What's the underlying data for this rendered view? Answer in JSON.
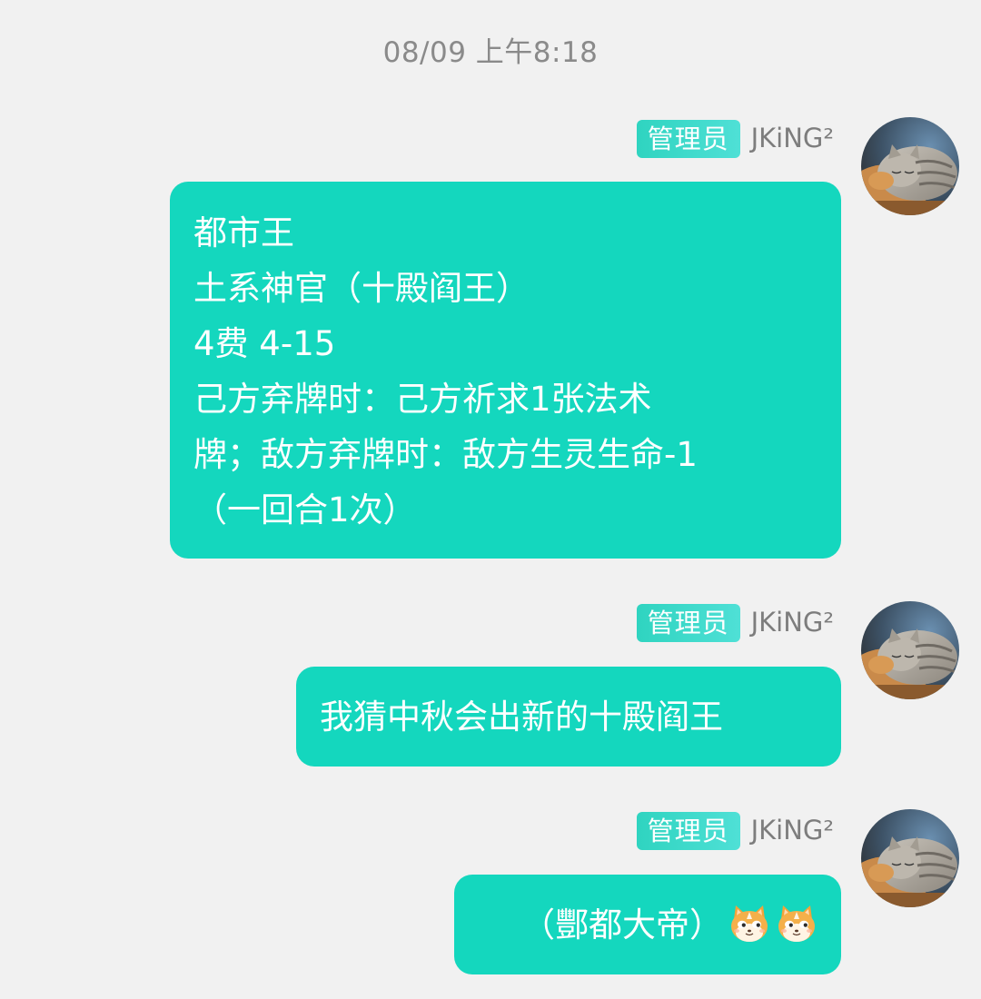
{
  "timestamp": "08/09 上午8:18",
  "messages": [
    {
      "badge": "管理员",
      "sender": "JKiNG²",
      "lines": [
        "都市王",
        "土系神官（十殿阎王）",
        "4费 4-15",
        "己方弃牌时：己方祈求1张法术",
        "牌；敌方弃牌时：敌方生灵生命-1",
        "（一回合1次）"
      ]
    },
    {
      "badge": "管理员",
      "sender": "JKiNG²",
      "text": "我猜中秋会出新的十殿阎王"
    },
    {
      "badge": "管理员",
      "sender": "JKiNG²",
      "text": "（酆都大帝）",
      "emojis": [
        "cat-face-emoji",
        "cat-face-emoji"
      ]
    }
  ],
  "colors": {
    "background": "#f1f1f1",
    "bubble": "#14d7be",
    "badge": "#2fd4c0",
    "sender_name": "#7d7d7d",
    "timestamp": "#8a8a8a"
  }
}
